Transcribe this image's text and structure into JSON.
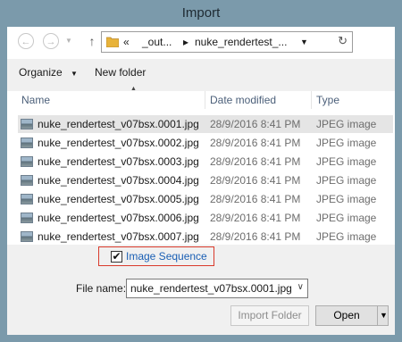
{
  "window": {
    "title": "Import"
  },
  "nav": {
    "back_glyph": "←",
    "forward_glyph": "→",
    "up_glyph": "↑",
    "crumbs": [
      "«",
      "_out...",
      "▸",
      "nuke_rendertest_..."
    ],
    "reload_glyph": "↻"
  },
  "toolbar": {
    "organize_label": "Organize",
    "organize_arrow": "▼",
    "new_folder_label": "New folder"
  },
  "sort_glyph": "▲",
  "columns": {
    "name": "Name",
    "date": "Date modified",
    "type": "Type"
  },
  "files": [
    {
      "name": "nuke_rendertest_v07bsx.0001.jpg",
      "date": "28/9/2016 8:41 PM",
      "type": "JPEG image",
      "selected": true
    },
    {
      "name": "nuke_rendertest_v07bsx.0002.jpg",
      "date": "28/9/2016 8:41 PM",
      "type": "JPEG image",
      "selected": false
    },
    {
      "name": "nuke_rendertest_v07bsx.0003.jpg",
      "date": "28/9/2016 8:41 PM",
      "type": "JPEG image",
      "selected": false
    },
    {
      "name": "nuke_rendertest_v07bsx.0004.jpg",
      "date": "28/9/2016 8:41 PM",
      "type": "JPEG image",
      "selected": false
    },
    {
      "name": "nuke_rendertest_v07bsx.0005.jpg",
      "date": "28/9/2016 8:41 PM",
      "type": "JPEG image",
      "selected": false
    },
    {
      "name": "nuke_rendertest_v07bsx.0006.jpg",
      "date": "28/9/2016 8:41 PM",
      "type": "JPEG image",
      "selected": false
    },
    {
      "name": "nuke_rendertest_v07bsx.0007.jpg",
      "date": "28/9/2016 8:41 PM",
      "type": "JPEG image",
      "selected": false
    }
  ],
  "options": {
    "image_sequence_label": "Image Sequence",
    "image_sequence_checked": true,
    "check_glyph": "✔",
    "file_name_label": "File name:",
    "file_name_value": "nuke_rendertest_v07bsx.0001.jpg",
    "file_name_arrow": "∨"
  },
  "buttons": {
    "import_folder_label": "Import Folder",
    "open_label": "Open",
    "open_arrow": "▼"
  },
  "colors": {
    "window_frame": "#7b9aab",
    "highlight_border": "#d93a2b",
    "link_text": "#1a5fb4"
  }
}
